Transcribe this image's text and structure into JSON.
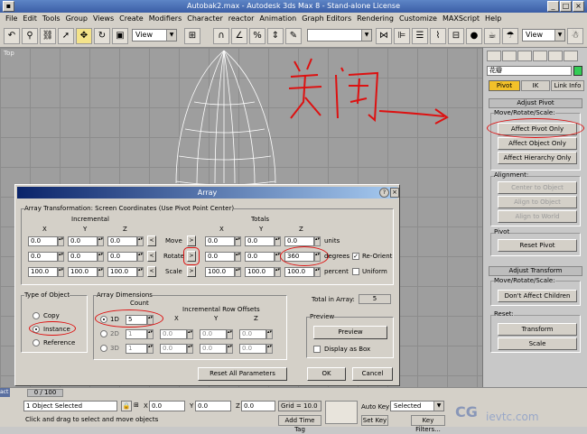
{
  "window": {
    "title": "Autobak2.max - Autodesk 3ds Max 8 - Stand-alone License"
  },
  "menu": [
    "File",
    "Edit",
    "Tools",
    "Group",
    "Views",
    "Create",
    "Modifiers",
    "Character",
    "reactor",
    "Animation",
    "Graph Editors",
    "Rendering",
    "Customize",
    "MAXScript",
    "Help"
  ],
  "toolbar": {
    "view_combo": "View",
    "view_combo2": "View"
  },
  "viewport": {
    "label": "Top"
  },
  "annotation": {
    "text": "关闭"
  },
  "panel": {
    "object_name": "花瓣",
    "tabs": [
      "Pivot",
      "IK",
      "Link Info"
    ],
    "adjust_pivot_header": "Adjust Pivot",
    "move_rotate_scale": "Move/Rotate/Scale:",
    "affect_pivot_only": "Affect Pivot Only",
    "affect_object_only": "Affect Object Only",
    "affect_hierarchy_only": "Affect Hierarchy Only",
    "alignment": "Alignment:",
    "center_to_object": "Center to Object",
    "align_to_object": "Align to Object",
    "align_to_world": "Align to World",
    "pivot_group": "Pivot",
    "reset_pivot": "Reset Pivot",
    "adjust_transform_header": "Adjust Transform",
    "move_rotate_scale2": "Move/Rotate/Scale:",
    "dont_affect_children": "Don't Affect Children",
    "reset_group": "Reset:",
    "transform_btn": "Transform",
    "scale_btn": "Scale"
  },
  "dialog": {
    "title": "Array",
    "transform_group": "Array Transformation: Screen Coordinates (Use Pivot Point Center)",
    "incremental": "Incremental",
    "totals": "Totals",
    "axes": [
      "X",
      "Y",
      "Z"
    ],
    "rows": [
      {
        "label": "Move",
        "inc": [
          "0.0",
          "0.0",
          "0.0"
        ],
        "tot": [
          "0.0",
          "0.0",
          "0.0"
        ],
        "unit": "units"
      },
      {
        "label": "Rotate",
        "inc": [
          "0.0",
          "0.0",
          "0.0"
        ],
        "tot": [
          "0.0",
          "0.0",
          "360"
        ],
        "unit": "degrees"
      },
      {
        "label": "Scale",
        "inc": [
          "100.0",
          "100.0",
          "100.0"
        ],
        "tot": [
          "100.0",
          "100.0",
          "100.0"
        ],
        "unit": "percent"
      }
    ],
    "re_orient": "Re-Orient",
    "uniform": "Uniform",
    "type_of_object": "Type of Object",
    "type_options": [
      "Copy",
      "Instance",
      "Reference"
    ],
    "array_dimensions": "Array Dimensions",
    "count_label": "Count",
    "incremental_row_offsets": "Incremental Row Offsets",
    "dims": [
      {
        "label": "1D",
        "count": "5"
      },
      {
        "label": "2D",
        "count": "1",
        "offsets": [
          "0.0",
          "0.0",
          "0.0"
        ]
      },
      {
        "label": "3D",
        "count": "1",
        "offsets": [
          "0.0",
          "0.0",
          "0.0"
        ]
      }
    ],
    "total_in_array_label": "Total in Array:",
    "total_in_array": "5",
    "preview_group": "Preview",
    "preview_btn": "Preview",
    "display_as_box": "Display as Box",
    "reset_all": "Reset All Parameters",
    "ok": "OK",
    "cancel": "Cancel"
  },
  "status": {
    "frame": "0 / 100",
    "selected": "1 Object Selected",
    "prompt": "Click and drag to select and move objects",
    "x": "0.0",
    "y": "0.0",
    "z": "0.0",
    "grid": "Grid = 10.0",
    "add_time_tag": "Add Time Tag",
    "auto_key": "Auto Key",
    "set_key": "Set Key",
    "key_filters": "Key Filters...",
    "selected_combo": "Selected",
    "act": "act"
  }
}
